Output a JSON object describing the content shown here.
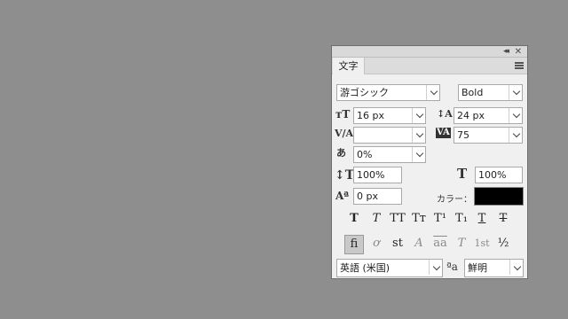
{
  "panel": {
    "collapse_icon": "◂◂",
    "close_icon": "✕",
    "tab_label": "文字"
  },
  "font": {
    "family": "游ゴシック",
    "style": "Bold"
  },
  "metrics": {
    "size": "16 px",
    "leading": "24 px",
    "kerning": "",
    "tracking": "75",
    "tsume": "0%",
    "vertical_scale": "100%",
    "horizontal_scale": "100%",
    "baseline_shift": "0 px",
    "color_label": "カラー：",
    "color": "#000000"
  },
  "style_buttons": [
    {
      "glyph": "T",
      "name": "faux-bold"
    },
    {
      "glyph": "T",
      "name": "faux-italic"
    },
    {
      "glyph": "TT",
      "name": "all-caps"
    },
    {
      "glyph": "Tт",
      "name": "small-caps"
    },
    {
      "glyph": "T¹",
      "name": "superscript"
    },
    {
      "glyph": "T₁",
      "name": "subscript"
    },
    {
      "glyph": "T",
      "name": "underline"
    },
    {
      "glyph": "T",
      "name": "strikethrough"
    }
  ],
  "opentype_buttons": [
    {
      "glyph": "fi",
      "name": "ligatures"
    },
    {
      "glyph": "ơ",
      "name": "discretionary-ligatures"
    },
    {
      "glyph": "st",
      "name": "swash"
    },
    {
      "glyph": "A",
      "name": "titling"
    },
    {
      "glyph": "aa",
      "name": "contextual-alternates"
    },
    {
      "glyph": "T",
      "name": "stylistic"
    },
    {
      "glyph": "1st",
      "name": "ordinals"
    },
    {
      "glyph": "½",
      "name": "fractions"
    }
  ],
  "footer": {
    "language": "英語 (米国)",
    "aa_label": "a",
    "antialias": "鮮明"
  }
}
